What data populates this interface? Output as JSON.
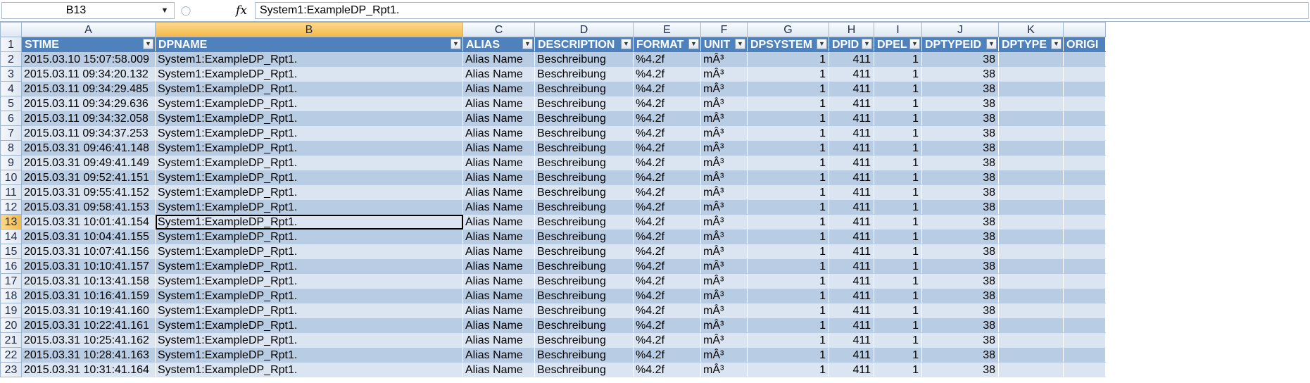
{
  "formula_bar": {
    "name_box": "B13",
    "fx_label": "fx",
    "formula": "System1:ExampleDP_Rpt1."
  },
  "columns": [
    "A",
    "B",
    "C",
    "D",
    "E",
    "F",
    "G",
    "H",
    "I",
    "J",
    "K",
    ""
  ],
  "selected_column": "B",
  "selected_row": "13",
  "headers": [
    "STIME",
    "DPNAME",
    "ALIAS",
    "DESCRIPTION",
    "FORMAT",
    "UNIT",
    "DPSYSTEM",
    "DPID",
    "DPEL",
    "DPTYPEID",
    "DPTYPE",
    "ORIGI"
  ],
  "rows": [
    {
      "n": "2",
      "stime": "2015.03.10 15:07:58.009"
    },
    {
      "n": "3",
      "stime": "2015.03.11 09:34:20.132"
    },
    {
      "n": "4",
      "stime": "2015.03.11 09:34:29.485"
    },
    {
      "n": "5",
      "stime": "2015.03.11 09:34:29.636"
    },
    {
      "n": "6",
      "stime": "2015.03.11 09:34:32.058"
    },
    {
      "n": "7",
      "stime": "2015.03.11 09:34:37.253"
    },
    {
      "n": "8",
      "stime": "2015.03.31 09:46:41.148"
    },
    {
      "n": "9",
      "stime": "2015.03.31 09:49:41.149"
    },
    {
      "n": "10",
      "stime": "2015.03.31 09:52:41.151"
    },
    {
      "n": "11",
      "stime": "2015.03.31 09:55:41.152"
    },
    {
      "n": "12",
      "stime": "2015.03.31 09:58:41.153"
    },
    {
      "n": "13",
      "stime": "2015.03.31 10:01:41.154"
    },
    {
      "n": "14",
      "stime": "2015.03.31 10:04:41.155"
    },
    {
      "n": "15",
      "stime": "2015.03.31 10:07:41.156"
    },
    {
      "n": "16",
      "stime": "2015.03.31 10:10:41.157"
    },
    {
      "n": "17",
      "stime": "2015.03.31 10:13:41.158"
    },
    {
      "n": "18",
      "stime": "2015.03.31 10:16:41.159"
    },
    {
      "n": "19",
      "stime": "2015.03.31 10:19:41.160"
    },
    {
      "n": "20",
      "stime": "2015.03.31 10:22:41.161"
    },
    {
      "n": "21",
      "stime": "2015.03.31 10:25:41.162"
    },
    {
      "n": "22",
      "stime": "2015.03.31 10:28:41.163"
    },
    {
      "n": "23",
      "stime": "2015.03.31 10:31:41.164"
    }
  ],
  "row_values": {
    "dpname": "System1:ExampleDP_Rpt1.",
    "alias": "Alias Name",
    "description": "Beschreibung",
    "format": "%4.2f",
    "unit": "mÂ³",
    "dpsystem": "1",
    "dpid": "411",
    "dpel": "1",
    "dptypeid": "38",
    "dptype": "",
    "origin": ""
  }
}
